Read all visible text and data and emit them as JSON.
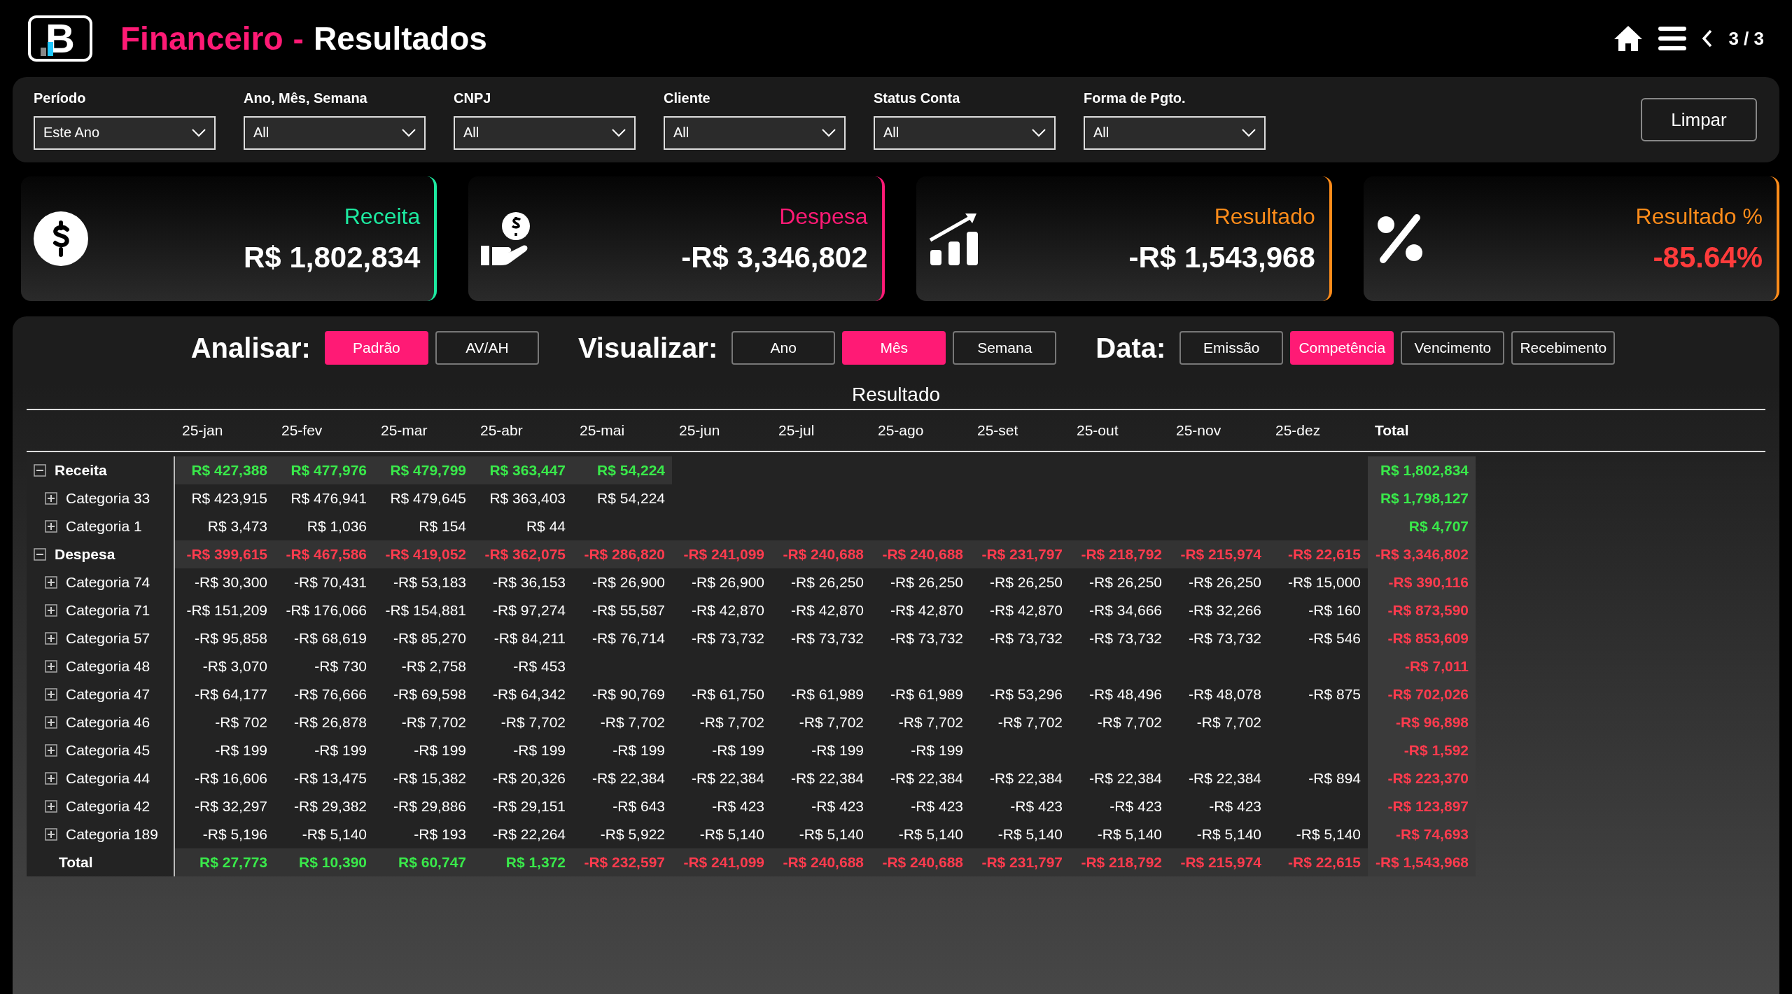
{
  "header": {
    "logo_text": "B",
    "section": "Financeiro",
    "separator": "-",
    "page": "Resultados",
    "pager": "3 / 3"
  },
  "filters": [
    {
      "label": "Período",
      "value": "Este Ano"
    },
    {
      "label": "Ano, Mês, Semana",
      "value": "All"
    },
    {
      "label": "CNPJ",
      "value": "All"
    },
    {
      "label": "Cliente",
      "value": "All"
    },
    {
      "label": "Status Conta",
      "value": "All"
    },
    {
      "label": "Forma de Pgto.",
      "value": "All"
    }
  ],
  "clear_button": "Limpar",
  "kpis": [
    {
      "label": "Receita",
      "value": "R$ 1,802,834",
      "color": "#1de9a0",
      "value_negative": false
    },
    {
      "label": "Despesa",
      "value": "-R$ 3,346,802",
      "color": "#ff1a75",
      "value_negative": false
    },
    {
      "label": "Resultado",
      "value": "-R$ 1,543,968",
      "color": "#ff8c1a",
      "value_negative": false
    },
    {
      "label": "Resultado %",
      "value": "-85.64%",
      "color": "#ff8c1a",
      "value_negative": true
    }
  ],
  "toggle_groups": [
    {
      "label": "Analisar:",
      "options": [
        {
          "label": "Padrão",
          "selected": true
        },
        {
          "label": "AV/AH",
          "selected": false
        }
      ]
    },
    {
      "label": "Visualizar:",
      "options": [
        {
          "label": "Ano",
          "selected": false
        },
        {
          "label": "Mês",
          "selected": true
        },
        {
          "label": "Semana",
          "selected": false
        }
      ]
    },
    {
      "label": "Data:",
      "options": [
        {
          "label": "Emissão",
          "selected": false
        },
        {
          "label": "Competência",
          "selected": true
        },
        {
          "label": "Vencimento",
          "selected": false
        },
        {
          "label": "Recebimento",
          "selected": false
        }
      ]
    }
  ],
  "table": {
    "title": "Resultado",
    "columns": [
      "25-jan",
      "25-fev",
      "25-mar",
      "25-abr",
      "25-mai",
      "25-jun",
      "25-jul",
      "25-ago",
      "25-set",
      "25-out",
      "25-nov",
      "25-dez",
      "Total"
    ],
    "rows": [
      {
        "kind": "group",
        "label": "Receita",
        "expanded": true,
        "negative": false,
        "months": [
          "R$ 427,388",
          "R$ 477,976",
          "R$ 479,799",
          "R$ 363,447",
          "R$ 54,224"
        ],
        "total": "R$ 1,802,834"
      },
      {
        "kind": "item",
        "label": "Categoria 33",
        "expanded": false,
        "negative": false,
        "months": [
          "R$ 423,915",
          "R$ 476,941",
          "R$ 479,645",
          "R$ 363,403",
          "R$ 54,224"
        ],
        "total": "R$ 1,798,127"
      },
      {
        "kind": "item",
        "label": "Categoria 1",
        "expanded": false,
        "negative": false,
        "months": [
          "R$ 3,473",
          "R$ 1,036",
          "R$ 154",
          "R$ 44"
        ],
        "total": "R$ 4,707"
      },
      {
        "kind": "group",
        "label": "Despesa",
        "expanded": true,
        "negative": true,
        "months": [
          "-R$ 399,615",
          "-R$ 467,586",
          "-R$ 419,052",
          "-R$ 362,075",
          "-R$ 286,820",
          "-R$ 241,099",
          "-R$ 240,688",
          "-R$ 240,688",
          "-R$ 231,797",
          "-R$ 218,792",
          "-R$ 215,974",
          "-R$ 22,615"
        ],
        "total": "-R$ 3,346,802"
      },
      {
        "kind": "item",
        "label": "Categoria 74",
        "expanded": false,
        "negative": true,
        "months": [
          "-R$ 30,300",
          "-R$ 70,431",
          "-R$ 53,183",
          "-R$ 36,153",
          "-R$ 26,900",
          "-R$ 26,900",
          "-R$ 26,250",
          "-R$ 26,250",
          "-R$ 26,250",
          "-R$ 26,250",
          "-R$ 26,250",
          "-R$ 15,000"
        ],
        "total": "-R$ 390,116"
      },
      {
        "kind": "item",
        "label": "Categoria 71",
        "expanded": false,
        "negative": true,
        "months": [
          "-R$ 151,209",
          "-R$ 176,066",
          "-R$ 154,881",
          "-R$ 97,274",
          "-R$ 55,587",
          "-R$ 42,870",
          "-R$ 42,870",
          "-R$ 42,870",
          "-R$ 42,870",
          "-R$ 34,666",
          "-R$ 32,266",
          "-R$ 160"
        ],
        "total": "-R$ 873,590"
      },
      {
        "kind": "item",
        "label": "Categoria 57",
        "expanded": false,
        "negative": true,
        "months": [
          "-R$ 95,858",
          "-R$ 68,619",
          "-R$ 85,270",
          "-R$ 84,211",
          "-R$ 76,714",
          "-R$ 73,732",
          "-R$ 73,732",
          "-R$ 73,732",
          "-R$ 73,732",
          "-R$ 73,732",
          "-R$ 73,732",
          "-R$ 546"
        ],
        "total": "-R$ 853,609"
      },
      {
        "kind": "item",
        "label": "Categoria 48",
        "expanded": false,
        "negative": true,
        "months": [
          "-R$ 3,070",
          "-R$ 730",
          "-R$ 2,758",
          "-R$ 453"
        ],
        "total": "-R$ 7,011"
      },
      {
        "kind": "item",
        "label": "Categoria 47",
        "expanded": false,
        "negative": true,
        "months": [
          "-R$ 64,177",
          "-R$ 76,666",
          "-R$ 69,598",
          "-R$ 64,342",
          "-R$ 90,769",
          "-R$ 61,750",
          "-R$ 61,989",
          "-R$ 61,989",
          "-R$ 53,296",
          "-R$ 48,496",
          "-R$ 48,078",
          "-R$ 875"
        ],
        "total": "-R$ 702,026"
      },
      {
        "kind": "item",
        "label": "Categoria 46",
        "expanded": false,
        "negative": true,
        "months": [
          "-R$ 702",
          "-R$ 26,878",
          "-R$ 7,702",
          "-R$ 7,702",
          "-R$ 7,702",
          "-R$ 7,702",
          "-R$ 7,702",
          "-R$ 7,702",
          "-R$ 7,702",
          "-R$ 7,702",
          "-R$ 7,702"
        ],
        "total": "-R$ 96,898"
      },
      {
        "kind": "item",
        "label": "Categoria 45",
        "expanded": false,
        "negative": true,
        "months": [
          "-R$ 199",
          "-R$ 199",
          "-R$ 199",
          "-R$ 199",
          "-R$ 199",
          "-R$ 199",
          "-R$ 199",
          "-R$ 199"
        ],
        "total": "-R$ 1,592"
      },
      {
        "kind": "item",
        "label": "Categoria 44",
        "expanded": false,
        "negative": true,
        "months": [
          "-R$ 16,606",
          "-R$ 13,475",
          "-R$ 15,382",
          "-R$ 20,326",
          "-R$ 22,384",
          "-R$ 22,384",
          "-R$ 22,384",
          "-R$ 22,384",
          "-R$ 22,384",
          "-R$ 22,384",
          "-R$ 22,384",
          "-R$ 894"
        ],
        "total": "-R$ 223,370"
      },
      {
        "kind": "item",
        "label": "Categoria 42",
        "expanded": false,
        "negative": true,
        "months": [
          "-R$ 32,297",
          "-R$ 29,382",
          "-R$ 29,886",
          "-R$ 29,151",
          "-R$ 643",
          "-R$ 423",
          "-R$ 423",
          "-R$ 423",
          "-R$ 423",
          "-R$ 423",
          "-R$ 423"
        ],
        "total": "-R$ 123,897"
      },
      {
        "kind": "item",
        "label": "Categoria 189",
        "expanded": false,
        "negative": true,
        "months": [
          "-R$ 5,196",
          "-R$ 5,140",
          "-R$ 193",
          "-R$ 22,264",
          "-R$ 5,922",
          "-R$ 5,140",
          "-R$ 5,140",
          "-R$ 5,140",
          "-R$ 5,140",
          "-R$ 5,140",
          "-R$ 5,140",
          "-R$ 5,140"
        ],
        "total": "-R$ 74,693"
      },
      {
        "kind": "total",
        "label": "Total",
        "negative": true,
        "months": [
          {
            "text": "R$ 27,773",
            "negative": false
          },
          {
            "text": "R$ 10,390",
            "negative": false
          },
          {
            "text": "R$ 60,747",
            "negative": false
          },
          {
            "text": "R$ 1,372",
            "negative": false
          },
          {
            "text": "-R$ 232,597",
            "negative": true
          },
          {
            "text": "-R$ 241,099",
            "negative": true
          },
          {
            "text": "-R$ 240,688",
            "negative": true
          },
          {
            "text": "-R$ 240,688",
            "negative": true
          },
          {
            "text": "-R$ 231,797",
            "negative": true
          },
          {
            "text": "-R$ 218,792",
            "negative": true
          },
          {
            "text": "-R$ 215,974",
            "negative": true
          },
          {
            "text": "-R$ 22,615",
            "negative": true
          }
        ],
        "total": "-R$ 1,543,968"
      }
    ]
  }
}
